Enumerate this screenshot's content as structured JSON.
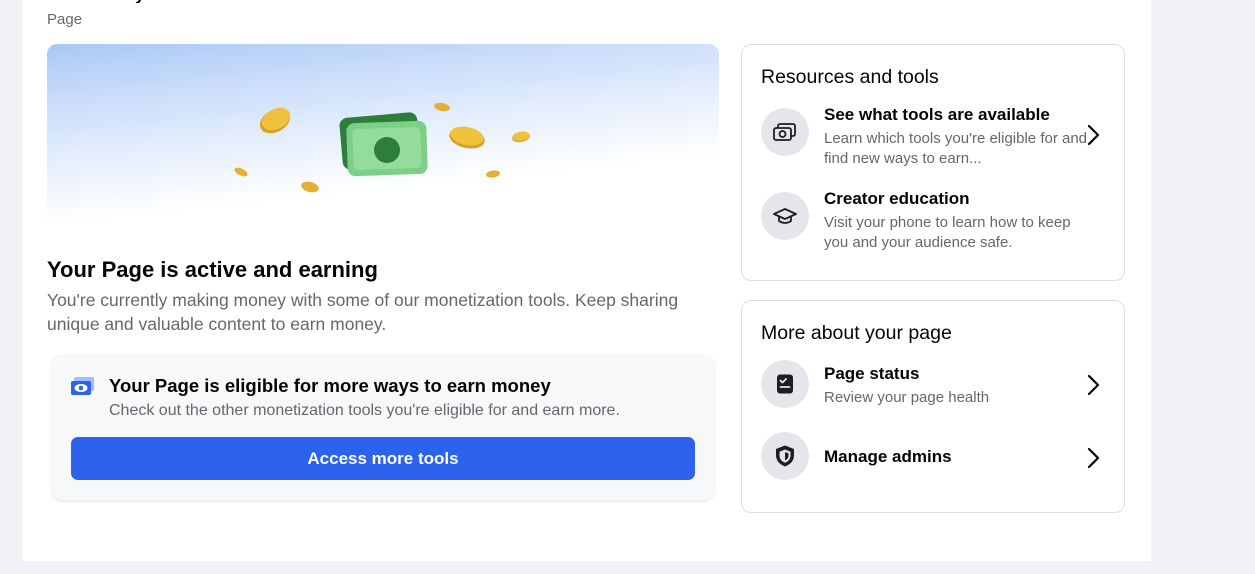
{
  "header": {
    "title_partial": "y",
    "page_label": "Page"
  },
  "status": {
    "title": "Your Page is active and earning",
    "description": "You're currently making money with some of our monetization tools. Keep sharing unique and valuable content to earn money."
  },
  "eligible": {
    "title": "Your Page is eligible for more ways to earn money",
    "description": "Check out the other monetization tools you're eligible for and earn more.",
    "button_label": "Access more tools"
  },
  "resources": {
    "title": "Resources and tools",
    "items": [
      {
        "title": "See what tools are available",
        "description": "Learn which tools you're eligible for and find new ways to earn..."
      },
      {
        "title": "Creator education",
        "description": "Visit your phone to learn how to keep you and your audience safe."
      }
    ]
  },
  "more_about": {
    "title": "More about your page",
    "items": [
      {
        "title": "Page status",
        "description": "Review your page health"
      },
      {
        "title": "Manage admins"
      }
    ]
  },
  "colors": {
    "accent_button": "#2d63ec",
    "secondary_text": "#65676b",
    "icon_bg": "#e4e6eb"
  }
}
